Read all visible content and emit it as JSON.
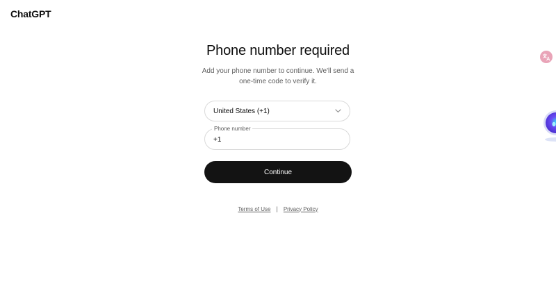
{
  "header": {
    "brand": "ChatGPT"
  },
  "main": {
    "title": "Phone number required",
    "subtitle": "Add your phone number to continue. We'll send a one-time code to verify it.",
    "country_select": {
      "value": "United States (+1)"
    },
    "phone_field": {
      "label": "Phone number",
      "value": "+1"
    },
    "continue_label": "Continue"
  },
  "footer": {
    "terms": "Terms of Use",
    "separator": "|",
    "privacy": "Privacy Policy"
  },
  "side_widgets": {
    "translate_icon": "translate-icon",
    "assistant_icon": "assistant-orb-icon"
  },
  "colors": {
    "primary_button": "#131313",
    "border": "#d9d9d9",
    "muted_text": "#5d5d5d",
    "translate_badge": "#e9a4b8",
    "assistant_orb": "#6a4cf5"
  }
}
